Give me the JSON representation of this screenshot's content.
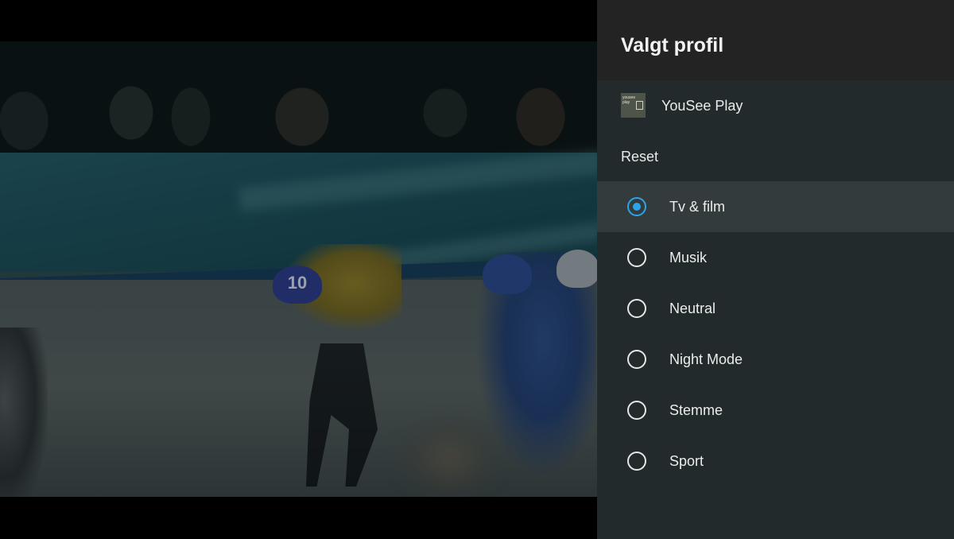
{
  "panel": {
    "title": "Valgt profil",
    "app": {
      "name": "YouSee Play",
      "icon_text": "yousee\nplay"
    },
    "reset_label": "Reset",
    "options": [
      {
        "label": "Tv & film",
        "selected": true
      },
      {
        "label": "Musik",
        "selected": false
      },
      {
        "label": "Neutral",
        "selected": false
      },
      {
        "label": "Night Mode",
        "selected": false
      },
      {
        "label": "Stemme",
        "selected": false
      },
      {
        "label": "Sport",
        "selected": false
      }
    ]
  },
  "video": {
    "helmet_number_1": "10"
  },
  "colors": {
    "accent": "#2ba5e8",
    "panel_bg": "#232a2c",
    "header_bg": "#232323",
    "selected_row_bg": "#333b3d"
  }
}
